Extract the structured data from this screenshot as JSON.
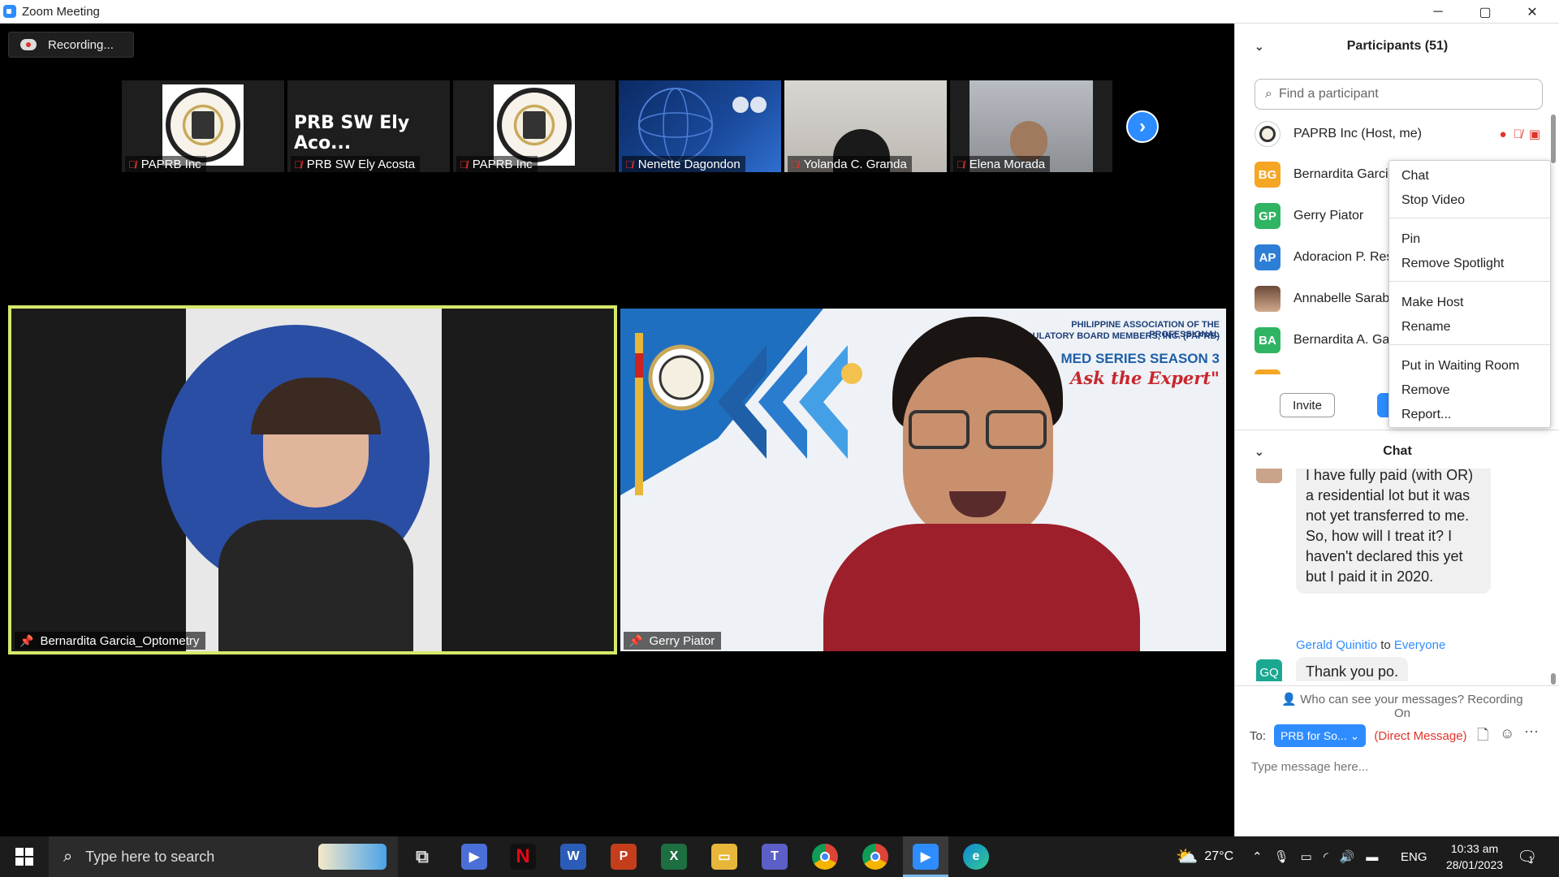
{
  "window": {
    "title": "Zoom Meeting",
    "controls": [
      "─",
      "▢",
      "✕"
    ]
  },
  "recording": {
    "label": "Recording..."
  },
  "strip": {
    "tiles": [
      {
        "name": "PAPRB Inc",
        "kind": "logo"
      },
      {
        "name": "PRB SW Ely Acosta",
        "kind": "text",
        "display": "PRB SW Ely Aco..."
      },
      {
        "name": "PAPRB Inc",
        "kind": "logo"
      },
      {
        "name": "Nenette Dagondon",
        "kind": "poster"
      },
      {
        "name": "Yolanda C. Granda",
        "kind": "camera"
      },
      {
        "name": "Elena Morada",
        "kind": "camera"
      }
    ]
  },
  "main": {
    "tiles": [
      {
        "name": "Bernardita Garcia_Optometry"
      },
      {
        "name": "Gerry Piator",
        "banner_line1": "PHILIPPINE ASSOCIATION OF THE PROFESSIONAL",
        "banner_line2": "REGULATORY BOARD MEMBERS, INC. (PAPRB)",
        "banner_line3": "MED SERIES SEASON 3",
        "banner_line4": "Ask the Expert\""
      }
    ]
  },
  "participants": {
    "header": "Participants (51)",
    "search_placeholder": "Find a participant",
    "list": [
      {
        "initials": "",
        "name": "PAPRB Inc (Host, me)",
        "color": "#ffffff"
      },
      {
        "initials": "BG",
        "name": "Bernardita Garcia",
        "color": "#f5a623"
      },
      {
        "initials": "GP",
        "name": "Gerry Piator",
        "color": "#2fb463"
      },
      {
        "initials": "AP",
        "name": "Adoracion P. Res",
        "color": "#2d7ed6"
      },
      {
        "initials": "",
        "name": "Annabelle Sarab",
        "color": "#c9a38a"
      },
      {
        "initials": "BA",
        "name": "Bernardita A. Ga",
        "color": "#2fb463"
      }
    ],
    "invite_label": "Invite"
  },
  "context_menu": {
    "items": [
      "Chat",
      "Stop Video",
      "Pin",
      "Remove Spotlight",
      "Make Host",
      "Rename",
      "Put in Waiting Room",
      "Remove",
      "Report..."
    ]
  },
  "chat": {
    "header": "Chat",
    "messages": [
      {
        "lines": [
          "I have fully paid (with OR)",
          "a residential lot but it was",
          "not yet transferred to me.",
          "So, how will I treat it? I",
          "haven't declared this yet",
          "but I paid it in 2020."
        ]
      },
      {
        "sender": "Gerald Quinitio",
        "to_word": "to",
        "recipient": "Everyone",
        "initials": "GQ",
        "text": "Thank you po."
      }
    ],
    "notice": "Who can see your messages? Recording On",
    "to_label": "To:",
    "to_value": "PRB for So...",
    "direct_label": "(Direct Message)",
    "input_placeholder": "Type message here..."
  },
  "taskbar": {
    "search_placeholder": "Type here to search",
    "temperature": "27°C",
    "language": "ENG",
    "time": "10:33 am",
    "date": "28/01/2023",
    "notification_count": "1"
  }
}
